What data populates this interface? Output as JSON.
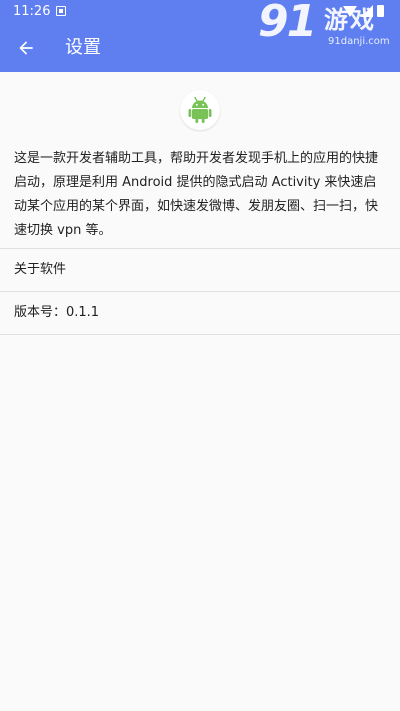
{
  "status_bar": {
    "time": "11:26",
    "icons": [
      "notification-icon",
      "wifi-icon",
      "signal-icon",
      "battery-icon"
    ]
  },
  "watermark": {
    "number": "91",
    "brand": "游戏",
    "url": "91danji.com"
  },
  "toolbar": {
    "back_icon": "arrow-back-icon",
    "title": "设置"
  },
  "about": {
    "logo_icon": "android-robot-icon",
    "description": "这是一款开发者辅助工具，帮助开发者发现手机上的应用的快捷启动，原理是利用 Android 提供的隐式启动 Activity 来快速启动某个应用的某个界面，如快速发微博、发朋友圈、扫一扫，快速切换 vpn 等。"
  },
  "list": {
    "about_software": "关于软件",
    "version": "版本号：0.1.1"
  },
  "colors": {
    "primary": "#5f7ff0",
    "background": "#fafafa",
    "android_green": "#78c257",
    "divider": "#e0e0e0"
  }
}
